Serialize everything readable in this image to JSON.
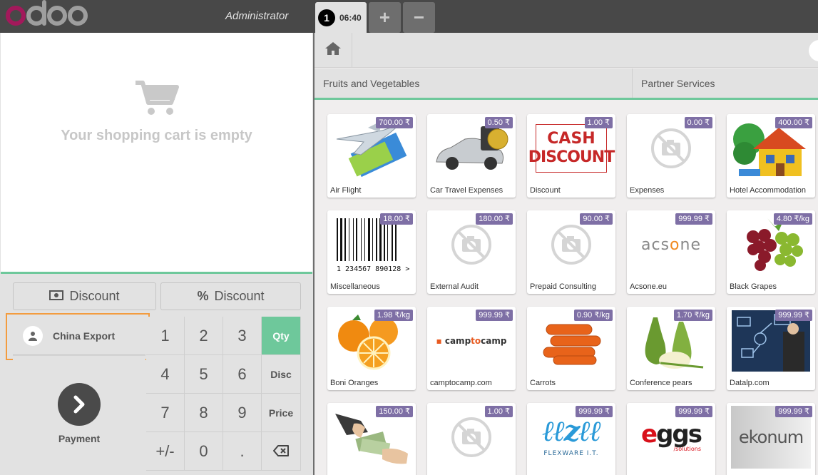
{
  "header": {
    "username": "Administrator",
    "order": {
      "number": "1",
      "time": "06:40"
    },
    "add_order": "+",
    "remove_order": "−"
  },
  "cart": {
    "empty_text": "Your shopping cart is empty"
  },
  "discounts": {
    "fixed_label": "Discount",
    "percent_label": "Discount"
  },
  "customer": {
    "name": "China Export"
  },
  "payment": {
    "label": "Payment"
  },
  "numpad": {
    "k1": "1",
    "k2": "2",
    "k3": "3",
    "k4": "4",
    "k5": "5",
    "k6": "6",
    "k7": "7",
    "k8": "8",
    "k9": "9",
    "sign": "+/-",
    "k0": "0",
    "dot": ".",
    "qty": "Qty",
    "disc": "Disc",
    "price": "Price"
  },
  "categories": [
    "Fruits and Vegetables",
    "Partner Services"
  ],
  "products": [
    {
      "name": "Air Flight",
      "price": "700.00 ₹",
      "icon": "airplane-ticket"
    },
    {
      "name": "Car Travel Expenses",
      "price": "0.50 ₹",
      "icon": "car-coins"
    },
    {
      "name": "Discount",
      "price": "1.00 ₹",
      "icon": "cash-discount-sign"
    },
    {
      "name": "Expenses",
      "price": "0.00 ₹",
      "icon": "no-image"
    },
    {
      "name": "Hotel Accommodation",
      "price": "400.00 ₹",
      "icon": "house"
    },
    {
      "name": "Miscellaneous",
      "price": "18.00 ₹",
      "icon": "barcode"
    },
    {
      "name": "External Audit",
      "price": "180.00 ₹",
      "icon": "no-image"
    },
    {
      "name": "Prepaid Consulting",
      "price": "90.00 ₹",
      "icon": "no-image"
    },
    {
      "name": "Acsone.eu",
      "price": "999.99 ₹",
      "icon": "acsone-logo"
    },
    {
      "name": "Black Grapes",
      "price": "4.80 ₹/kg",
      "icon": "grapes"
    },
    {
      "name": "Boni Oranges",
      "price": "1.98 ₹/kg",
      "icon": "oranges"
    },
    {
      "name": "camptocamp.com",
      "price": "999.99 ₹",
      "icon": "camptocamp-logo"
    },
    {
      "name": "Carrots",
      "price": "0.90 ₹/kg",
      "icon": "carrots"
    },
    {
      "name": "Conference pears",
      "price": "1.70 ₹/kg",
      "icon": "pears"
    },
    {
      "name": "Datalp.com",
      "price": "999.99 ₹",
      "icon": "datalp-image"
    },
    {
      "name": "",
      "price": "150.00 ₹",
      "icon": "money-hands"
    },
    {
      "name": "",
      "price": "1.00 ₹",
      "icon": "no-image"
    },
    {
      "name": "",
      "price": "999.99 ₹",
      "icon": "flexware-logo"
    },
    {
      "name": "",
      "price": "999.99 ₹",
      "icon": "eggs-logo"
    },
    {
      "name": "",
      "price": "999.99 ₹",
      "icon": "ekonum-logo"
    }
  ],
  "logos": {
    "cash_discount": [
      "CASH",
      "DISCOUNT"
    ],
    "barcode_digits": "1 234567 890128 >",
    "acsone": "acsone",
    "camptocamp_pre": "camp",
    "camptocamp_mid": "to",
    "camptocamp_post": "camp",
    "flexware_text": "FLEXWARE I.T.",
    "eggs": "eggs",
    "eggs_sub": "/solutions",
    "ekonum": "ekonum"
  },
  "colors": {
    "accent_green": "#6ec89b",
    "price_tag": "#7e6fa5",
    "highlight_orange": "#f39c3f",
    "topbar": "#484848"
  }
}
